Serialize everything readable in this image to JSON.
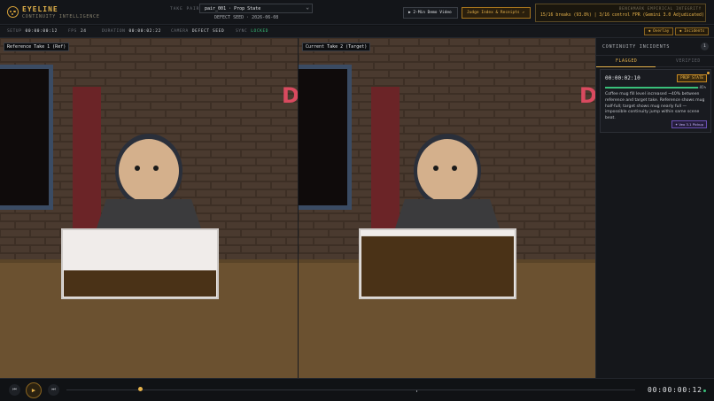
{
  "app": {
    "title": "EYELINE",
    "subtitle": "CONTINUITY INTELLIGENCE"
  },
  "take_pair": {
    "label": "TAKE PAIR:",
    "selected": "pair_001 · Prop State",
    "seed_line": "DEFECT SEED · 2026-06-08"
  },
  "buttons": {
    "demo": "▶ 2-Min Demo Video",
    "judge": "Judge Index & Receipts ↗"
  },
  "benchmark": {
    "title": "BENCHMARK EMPIRICAL INTEGRITY",
    "stats": "15/16 breaks (93.8%)  |  3/16 control FPR (Gemini 3.0 Adjudicated)"
  },
  "meta": {
    "setup_label": "SETUP",
    "setup_value": "00:00:00:12",
    "fps_label": "FPS",
    "fps_value": "24",
    "duration_label": "DURATION",
    "duration_value": "00:00:02:22",
    "camera_label": "CAMERA",
    "camera_value": "DEFECT SEED",
    "sync_label": "SYNC",
    "sync_value": "LOCKED",
    "overlay_pill": "◆ Overlay",
    "incidents_pill": "◆ Incidents"
  },
  "videos": {
    "left_label": "Reference Take 1 (Ref)",
    "right_label": "Current Take 2 (Target)",
    "sign_letter": "D"
  },
  "mug_fill": {
    "reference": 0.4,
    "target": 0.92
  },
  "panel": {
    "title": "CONTINUITY INCIDENTS",
    "count": "1",
    "tabs": [
      "FLAGGED",
      "VERIFIED"
    ],
    "incident": {
      "time": "00:00:02:10",
      "badge": "PROP STATE",
      "confidence_label": "95%",
      "confidence": 0.95,
      "description": "Coffee mug fill level increased ~40% between reference and target take. Reference shows mug half-full; target shows mug nearly full — impossible continuity jump within same scene beat.",
      "action": "✦ Veo 3.1 Pickup"
    }
  },
  "transport": {
    "prev_icon": "⏮",
    "play_icon": "▶",
    "next_icon": "⏭",
    "timecode": "00:00:00:12",
    "progress": 0.13
  },
  "colors": {
    "accent": "#e6b24b",
    "ok": "#39c07a",
    "veo": "#c9b8ff"
  }
}
